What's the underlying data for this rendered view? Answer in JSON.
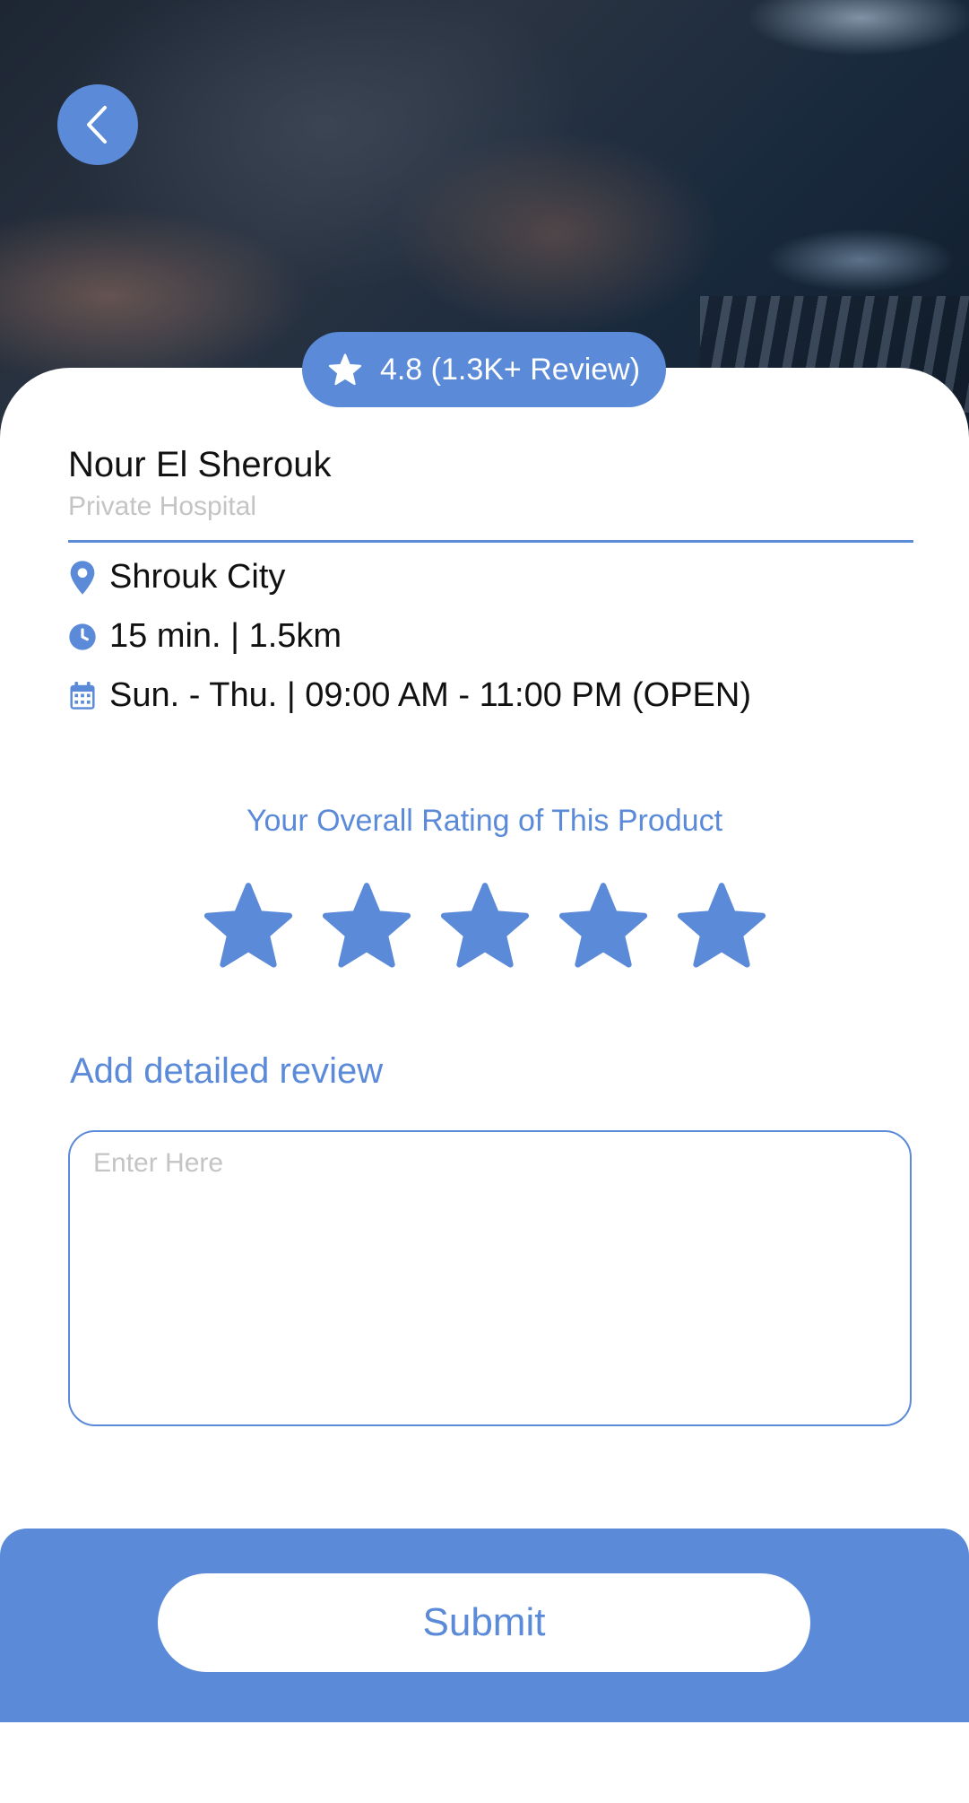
{
  "header": {
    "back_icon": "chevron-left-icon"
  },
  "rating_badge": {
    "icon": "star-icon",
    "text": "4.8 (1.3K+ Review)"
  },
  "place": {
    "name": "Nour El Sherouk",
    "category": "Private Hospital"
  },
  "info": {
    "location": {
      "icon": "location-pin-icon",
      "text": "Shrouk City"
    },
    "distance": {
      "icon": "clock-icon",
      "text": "15 min. | 1.5km"
    },
    "hours": {
      "icon": "calendar-icon",
      "text": "Sun. - Thu. | 09:00 AM - 11:00 PM (OPEN)"
    }
  },
  "rating": {
    "title": "Your Overall Rating of This Product",
    "selected": 5,
    "max": 5
  },
  "review": {
    "label": "Add detailed review",
    "placeholder": "Enter Here",
    "value": ""
  },
  "submit": {
    "label": "Submit"
  },
  "colors": {
    "accent": "#5a8ad8",
    "placeholder": "#c4c4c4",
    "text": "#111111"
  }
}
